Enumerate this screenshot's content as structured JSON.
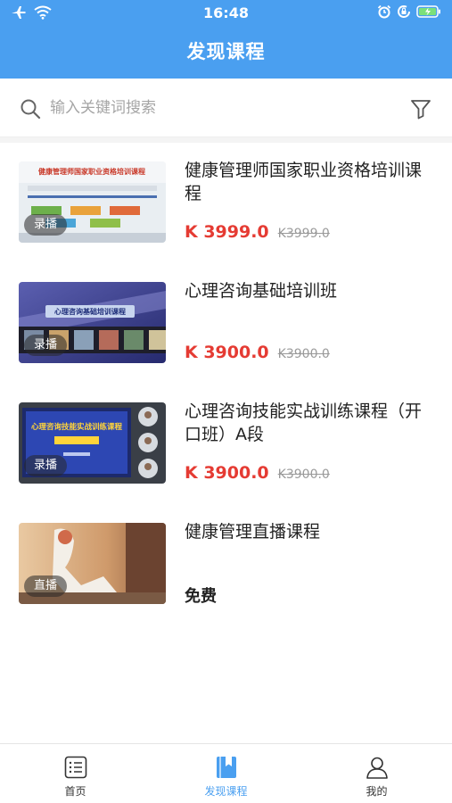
{
  "status_bar": {
    "time": "16:48"
  },
  "header": {
    "title": "发现课程"
  },
  "search": {
    "placeholder": "输入关键词搜索"
  },
  "courses": [
    {
      "title": "健康管理师国家职业资格培训课程",
      "badge": "录播",
      "price": "K 3999.0",
      "original_price": "K3999.0",
      "thumb_text": "健康管理师国家职业资格培训课程"
    },
    {
      "title": "心理咨询基础培训班",
      "badge": "录播",
      "price": "K 3900.0",
      "original_price": "K3900.0",
      "thumb_text": "心理咨询基础培训课程"
    },
    {
      "title": "心理咨询技能实战训练课程（开口班）A段",
      "badge": "录播",
      "price": "K 3900.0",
      "original_price": "K3900.0",
      "thumb_text": "心理咨询技能实战训练课程"
    },
    {
      "title": "健康管理直播课程",
      "badge": "直播",
      "price": "免费"
    }
  ],
  "tabs": [
    {
      "label": "首页",
      "icon": "home-list-icon",
      "active": false
    },
    {
      "label": "发现课程",
      "icon": "bookmark-book-icon",
      "active": true
    },
    {
      "label": "我的",
      "icon": "user-icon",
      "active": false
    }
  ],
  "colors": {
    "primary": "#4a9ff0",
    "price": "#e53b33"
  }
}
